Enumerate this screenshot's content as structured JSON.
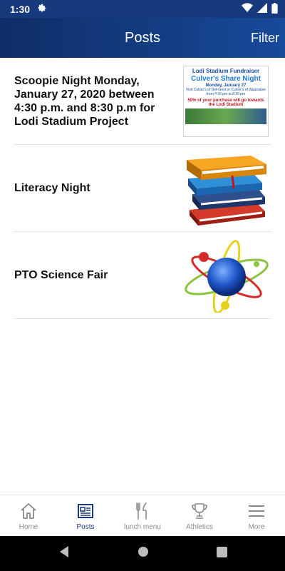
{
  "status_bar": {
    "time": "1:30",
    "icons": [
      "gear-icon",
      "wifi-icon",
      "signal-icon",
      "battery-icon"
    ]
  },
  "app_bar": {
    "title": "Posts",
    "filter_label": "Filter"
  },
  "posts": [
    {
      "title": "Scoopie Night  Monday, January 27, 2020 between 4:30 p.m. and 8:30 p.m for Lodi Stadium Project",
      "thumbnail": {
        "line1": "Lodi Stadium Fundraiser",
        "line2": "Culver's Share Night",
        "line3": "Monday, January 27",
        "line4": "Visit Culver's of DeForest or Culver's of Waunakee",
        "line5": "from 4:30 pm to 8:30 pm",
        "line6": "50% of your purchase will go towards the Lodi Stadium"
      }
    },
    {
      "title": "Literacy Night",
      "thumbnail_icon": "books-icon"
    },
    {
      "title": "PTO Science Fair",
      "thumbnail_icon": "atom-icon"
    }
  ],
  "bottom_nav": [
    {
      "label": "Home",
      "icon": "home-icon",
      "active": false
    },
    {
      "label": "Posts",
      "icon": "posts-icon",
      "active": true
    },
    {
      "label": "lunch menu",
      "icon": "fork-knife-icon",
      "active": false
    },
    {
      "label": "Athletics",
      "icon": "trophy-icon",
      "active": false
    },
    {
      "label": "More",
      "icon": "menu-icon",
      "active": false
    }
  ],
  "colors": {
    "header_dark": "#0f2d66",
    "header_light": "#174a9a",
    "nav_active": "#1c3a7a",
    "nav_inactive": "#8a8a8a"
  }
}
